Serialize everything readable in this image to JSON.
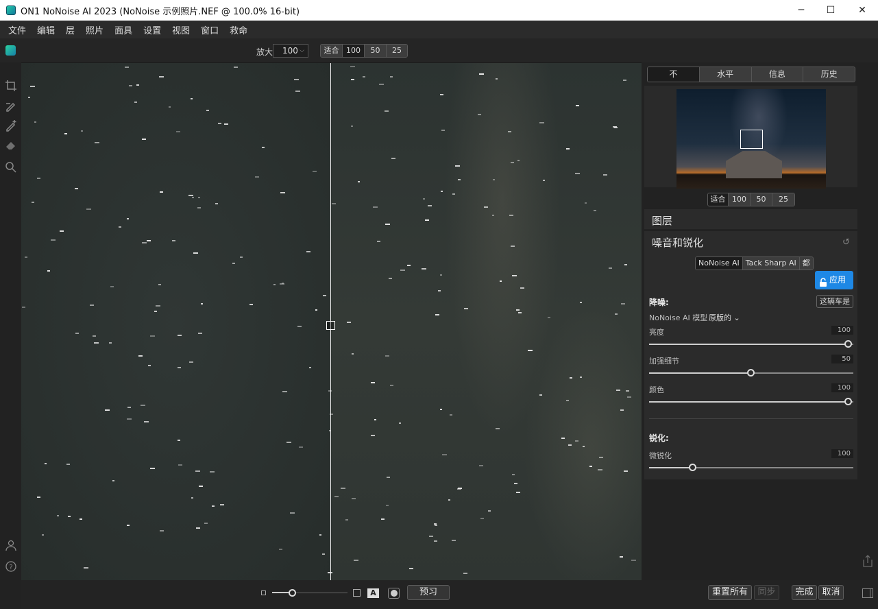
{
  "window": {
    "title": "ON1 NoNoise AI 2023 (NoNoise 示例照片.NEF @ 100.0% 16-bit)",
    "minimize": "─",
    "maximize": "☐",
    "close": "✕"
  },
  "menu": [
    "文件",
    "编辑",
    "层",
    "照片",
    "面具",
    "设置",
    "视图",
    "窗口",
    "救命"
  ],
  "toolbar": {
    "zoom_label": "放大",
    "zoom_value": "100",
    "zoom_presets": [
      "适合",
      "100",
      "50",
      "25"
    ],
    "active_preset": "100"
  },
  "left_tools": [
    "crop-icon",
    "brush-icon",
    "brush-plus-icon",
    "eraser-icon",
    "magnifier-icon",
    "user-icon",
    "help-icon"
  ],
  "right_panel": {
    "tabs": [
      "不",
      "水平",
      "信息",
      "历史"
    ],
    "active_tab": "不",
    "nav_zoom_presets": [
      "适合",
      "100",
      "50",
      "25"
    ],
    "layers_title": "图层",
    "noise_section_title": "噪音和锐化",
    "models": [
      "NoNoise AI",
      "Tack Sharp AI",
      "都"
    ],
    "active_model": "NoNoise AI",
    "apply_label": "应用",
    "denoise_label": "降噪:",
    "auto_button": "这辆车是",
    "model_label": "NoNoise AI 模型",
    "model_value": "原版的",
    "sliders": [
      {
        "label": "亮度",
        "value": "100"
      },
      {
        "label": "加强细节",
        "value": "50"
      },
      {
        "label": "颜色",
        "value": "100"
      }
    ],
    "sharpen_label": "锐化:",
    "sharpen_slider": {
      "label": "微锐化",
      "value": "100"
    }
  },
  "bottom": {
    "preview_label": "预习",
    "reset_all": "重置所有",
    "sync": "同步",
    "done": "完成",
    "cancel": "取消"
  },
  "colors": {
    "accent": "#1e88e5",
    "panel": "#2b2b2b",
    "background": "#1b1b1b"
  }
}
